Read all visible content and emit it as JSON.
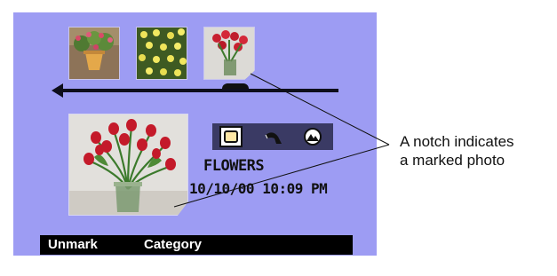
{
  "thumbnails": [
    {
      "icon": "potted-flowers-photo"
    },
    {
      "icon": "yellow-flowers-photo"
    },
    {
      "icon": "tulip-vase-photo",
      "marked": true
    }
  ],
  "modes": [
    {
      "icon": "picture-mode-icon",
      "active": true
    },
    {
      "icon": "scroll-mode-icon",
      "active": false
    },
    {
      "icon": "review-mode-icon",
      "active": false
    }
  ],
  "photo": {
    "category": "FLOWERS",
    "timestamp": "10/10/00 10:09 PM"
  },
  "softkeys": {
    "left_label": "Unmark",
    "right_label": "Category"
  },
  "annotation": {
    "line1": "A notch indicates",
    "line2": "a marked photo"
  },
  "colors": {
    "screen_background": "#9d9cf3",
    "softkey_bar": "#000000",
    "mode_bar": "#3a3a64"
  }
}
